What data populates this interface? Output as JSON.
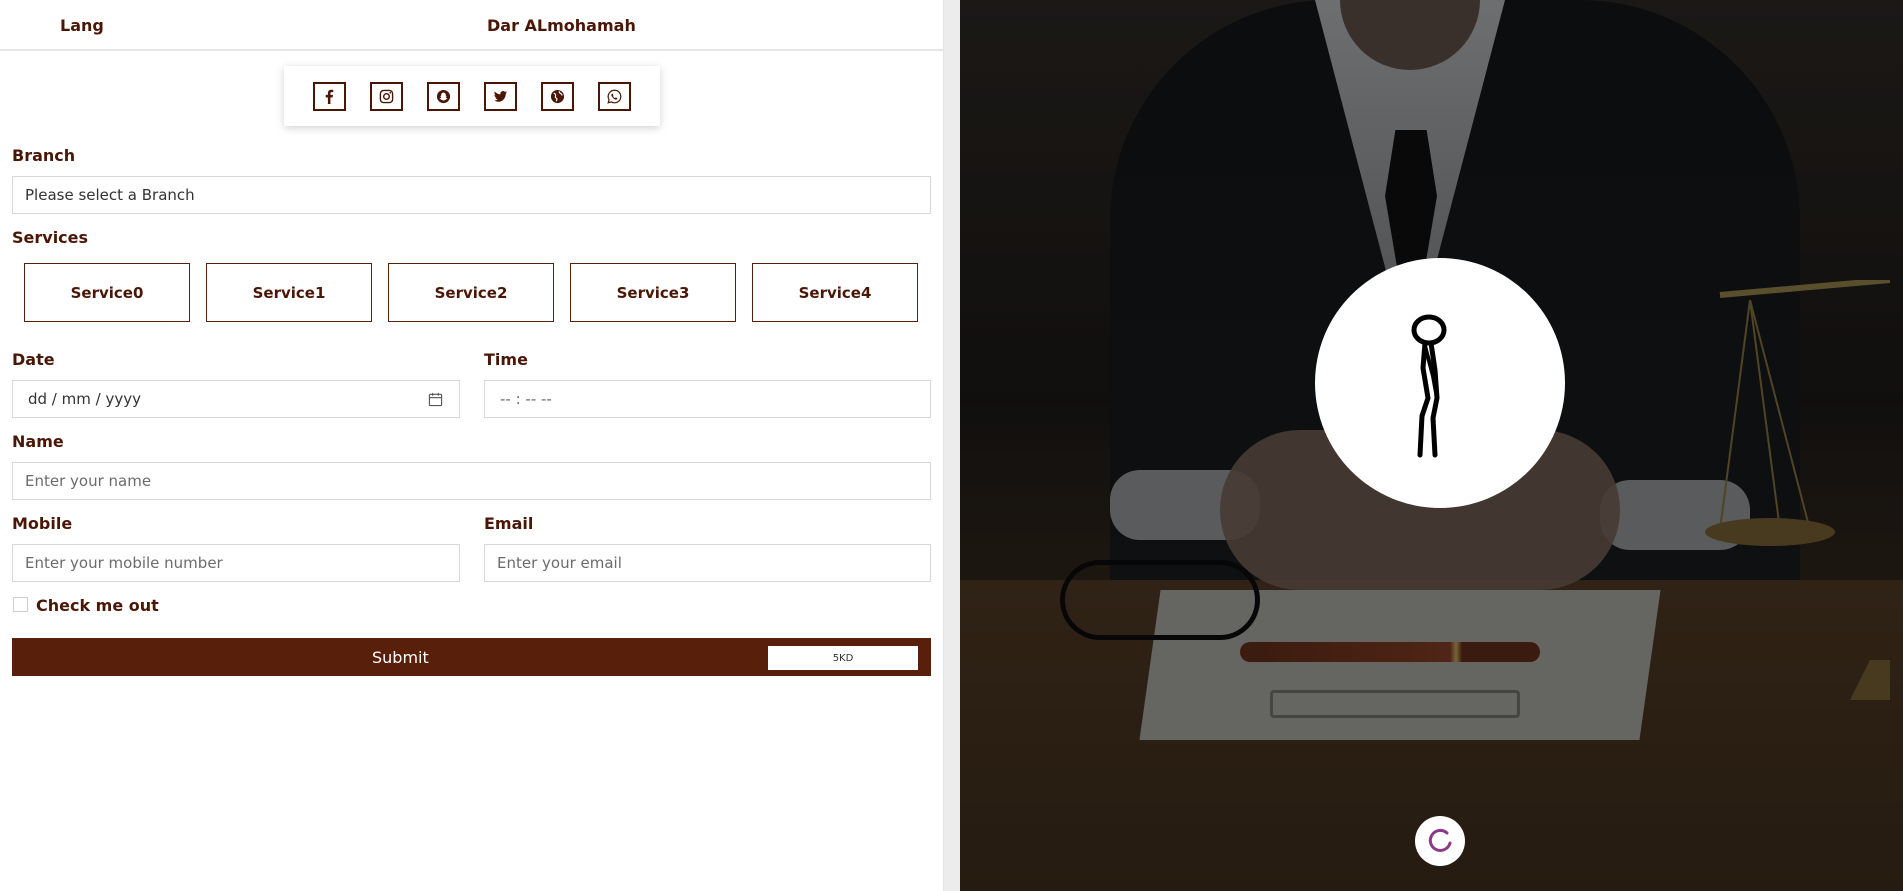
{
  "header": {
    "lang": "Lang",
    "brand": "Dar ALmohamah"
  },
  "social": [
    {
      "name": "facebook-icon"
    },
    {
      "name": "instagram-icon"
    },
    {
      "name": "snapchat-icon"
    },
    {
      "name": "twitter-icon"
    },
    {
      "name": "globe-icon"
    },
    {
      "name": "whatsapp-icon"
    }
  ],
  "form": {
    "branch_label": "Branch",
    "branch_value": "Please select a Branch",
    "services_label": "Services",
    "services": [
      "Service0",
      "Service1",
      "Service2",
      "Service3",
      "Service4"
    ],
    "date_label": "Date",
    "date_placeholder": "dd / mm / yyyy",
    "time_label": "Time",
    "time_placeholder": "-- : --   --",
    "name_label": "Name",
    "name_placeholder": "Enter your name",
    "mobile_label": "Mobile",
    "mobile_placeholder": "Enter your mobile number",
    "email_label": "Email",
    "email_placeholder": "Enter your email",
    "check_label": "Check me out",
    "submit_label": "Submit",
    "price": "5KD"
  },
  "colors": {
    "brand": "#58200b",
    "text": "#4a1707"
  }
}
